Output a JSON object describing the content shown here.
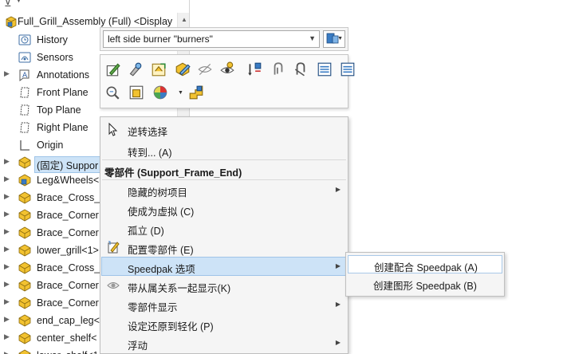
{
  "tree": {
    "root_label": "Full_Grill_Assembly (Full) <Display",
    "items": [
      {
        "label": "History",
        "icon": "history-icon",
        "expander": false
      },
      {
        "label": "Sensors",
        "icon": "sensors-icon",
        "expander": false
      },
      {
        "label": "Annotations",
        "icon": "annotations-icon",
        "expander": true
      },
      {
        "label": "Front Plane",
        "icon": "plane-icon",
        "expander": false
      },
      {
        "label": "Top Plane",
        "icon": "plane-icon",
        "expander": false
      },
      {
        "label": "Right Plane",
        "icon": "plane-icon",
        "expander": false
      },
      {
        "label": "Origin",
        "icon": "origin-icon",
        "expander": false
      },
      {
        "label": "(固定) Suppor",
        "icon": "part-icon",
        "expander": true,
        "selected": true
      },
      {
        "label": "Leg&Wheels<",
        "icon": "subassembly-icon",
        "expander": true
      },
      {
        "label": "Brace_Cross_E",
        "icon": "part-icon",
        "expander": true
      },
      {
        "label": "Brace_Corner",
        "icon": "part-icon",
        "expander": true
      },
      {
        "label": "Brace_Corner",
        "icon": "part-icon",
        "expander": true
      },
      {
        "label": "lower_grill<1>",
        "icon": "part-icon",
        "expander": true
      },
      {
        "label": "Brace_Cross_E",
        "icon": "part-icon",
        "expander": true
      },
      {
        "label": "Brace_Corner",
        "icon": "part-icon",
        "expander": true
      },
      {
        "label": "Brace_Corner",
        "icon": "part-icon",
        "expander": true
      },
      {
        "label": "end_cap_leg<",
        "icon": "part-icon",
        "expander": true
      },
      {
        "label": "center_shelf<",
        "icon": "part-icon",
        "expander": true
      },
      {
        "label": "lower_shelf<1",
        "icon": "part-icon",
        "expander": true
      }
    ]
  },
  "selection_bar": {
    "value": "left side burner  \"burners\""
  },
  "context_toolbar": {
    "row1": [
      "edit-part-icon",
      "smart-fastener-icon",
      "open-part-icon",
      "make-virtual-icon",
      "hide-icon",
      "isolate-icon",
      "fix-icon",
      "mate-icon",
      "paperclip-icon",
      "view-mates-icon",
      "properties-icon"
    ],
    "row2": [
      "zoom-to-selection-icon",
      "component-display-icon",
      "appearance-icon",
      "move-component-icon"
    ]
  },
  "context_menu": {
    "items": [
      {
        "label": "逆转选择",
        "icon": "cursor-icon",
        "has_sub": false
      },
      {
        "label": "转到... (A)",
        "icon": "",
        "has_sub": false
      },
      {
        "label": "隐藏的树项目",
        "icon": "",
        "has_sub": true
      },
      {
        "label": "使成为虚拟 (C)",
        "icon": "",
        "has_sub": false
      },
      {
        "label": "孤立 (D)",
        "icon": "",
        "has_sub": false
      },
      {
        "label": "配置零部件 (E)",
        "icon": "configure-icon",
        "has_sub": false
      },
      {
        "label": "Speedpak 选项",
        "icon": "",
        "has_sub": true,
        "highlighted": true
      },
      {
        "label": "带从属关系一起显示(K)",
        "icon": "show-with-dependents-icon",
        "has_sub": false
      },
      {
        "label": "零部件显示",
        "icon": "",
        "has_sub": true
      },
      {
        "label": "设定还原到轻化 (P)",
        "icon": "",
        "has_sub": false
      },
      {
        "label": "浮动",
        "icon": "",
        "has_sub": true
      }
    ],
    "header": "零部件 (Support_Frame_End)"
  },
  "submenu": {
    "items": [
      {
        "label": "创建配合 Speedpak (A)",
        "highlighted": true
      },
      {
        "label": "创建图形 Speedpak (B)",
        "highlighted": false
      }
    ]
  },
  "colors": {
    "highlight": "#cde3f7",
    "highlight_border": "#9fc4e8",
    "part_yellow": "#f2c230",
    "part_blue": "#3a7cc4"
  }
}
